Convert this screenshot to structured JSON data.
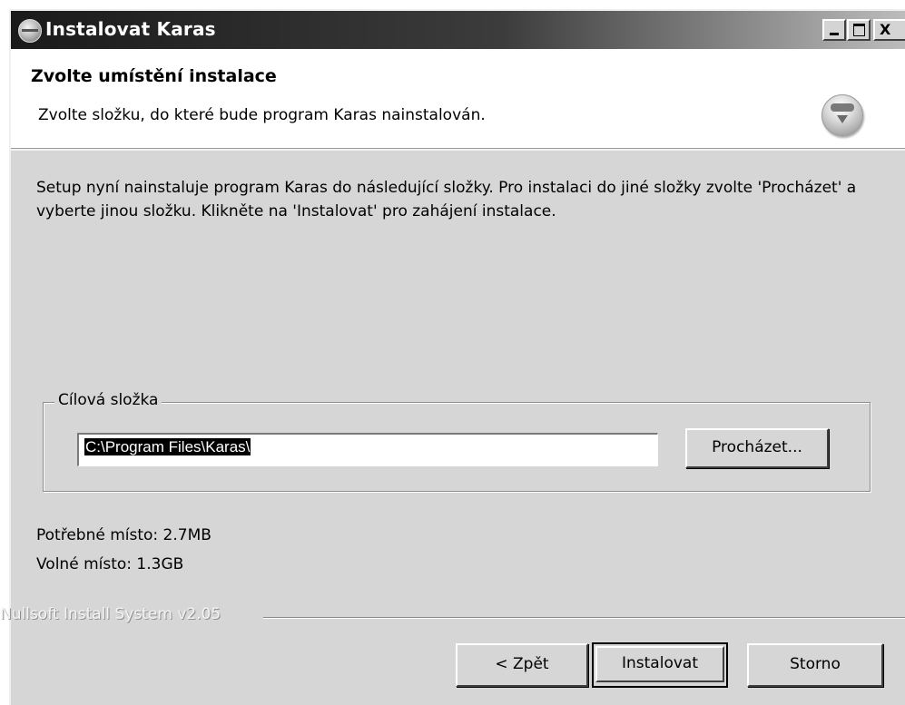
{
  "window": {
    "title": "Instalovat Karas",
    "close_glyph": "X"
  },
  "header": {
    "title": "Zvolte umístění instalace",
    "subtitle": "Zvolte složku, do které bude program Karas nainstalován."
  },
  "body": {
    "text": "Setup nyní nainstaluje program Karas do následující složky. Pro instalaci do jiné složky zvolte 'Procházet' a vyberte jinou složku. Klikněte na 'Instalovat' pro zahájení instalace."
  },
  "destination": {
    "group_label": "Cílová složka",
    "path_value": "C:\\Program Files\\Karas\\",
    "browse_label": "Procházet..."
  },
  "space": {
    "required": "Potřebné místo: 2.7MB",
    "free": "Volné místo: 1.3GB"
  },
  "branding": "Nullsoft Install System v2.05",
  "buttons": {
    "back": "< Zpět",
    "install": "Instalovat",
    "cancel": "Storno"
  },
  "icons": {
    "app": "installer-icon",
    "header_logo": "nsis-logo-icon"
  }
}
